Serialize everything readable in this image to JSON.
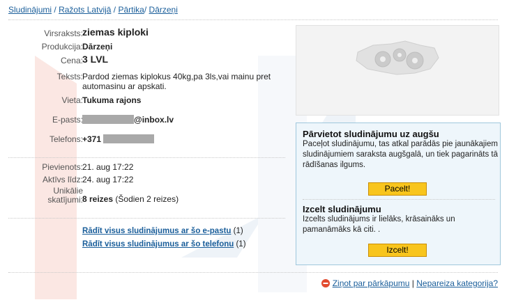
{
  "breadcrumb": {
    "items": [
      "Sludinājumi",
      "Ražots Latvijā",
      "Pārtika",
      "Dārzeņi"
    ],
    "separator": "/"
  },
  "ad": {
    "title_label": "Virsraksts:",
    "title": "ziemas kiploki",
    "product_label": "Produkcija:",
    "product": "Dārzeņi",
    "price_label": "Cena:",
    "price": "3 LVL",
    "text_label": "Teksts:",
    "text": "Pardod ziemas kiplokus 40kg,pa 3ls,vai mainu pret automasinu ar apskati.",
    "place_label": "Vieta:",
    "place": "Tukuma rajons",
    "email_label": "E-pasts:",
    "email_suffix": "@inbox.lv",
    "phone_label": "Telefons:",
    "phone_prefix": "+371",
    "added_label": "Pievienots:",
    "added": "21. aug 17:22",
    "active_label": "Aktīvs līdz:",
    "active": "24. aug 17:22",
    "views_label_1": "Unikālie",
    "views_label_2": "skatījumi:",
    "views_count": "8 reizes",
    "views_today": "(Šodien 2 reizes)"
  },
  "links": {
    "by_email": "Rādīt visus sludinājumus ar šo e-pastu",
    "by_email_count": "(1)",
    "by_phone": "Rādīt visus sludinājumus ar šo telefonu",
    "by_phone_count": "(1)"
  },
  "promo": {
    "move_title": "Pārvietot sludinājumu uz augšu",
    "move_text": "Paceļot sludinājumu, tas atkal parādās pie jaunākajiem sludinājumiem saraksta augšgalā, un tiek pagarināts tā rādīšanas ilgums.",
    "move_button": "Pacelt!",
    "highlight_title": "Izcelt sludinājumu",
    "highlight_text": "Izcelts sludinājums ir lielāks, krāsaināks un pamanāmāks kā citi. .",
    "highlight_button": "Izcelt!"
  },
  "footer": {
    "report": "Ziņot par pārkāpumu",
    "divider": "|",
    "wrong_category": "Nepareiza kategorija?"
  },
  "colors": {
    "link": "#1a5e9a",
    "button": "#f8c51d",
    "promo_bg": "#eef6fb",
    "promo_border": "#9fc7dc",
    "report_icon": "#e24b2f"
  }
}
